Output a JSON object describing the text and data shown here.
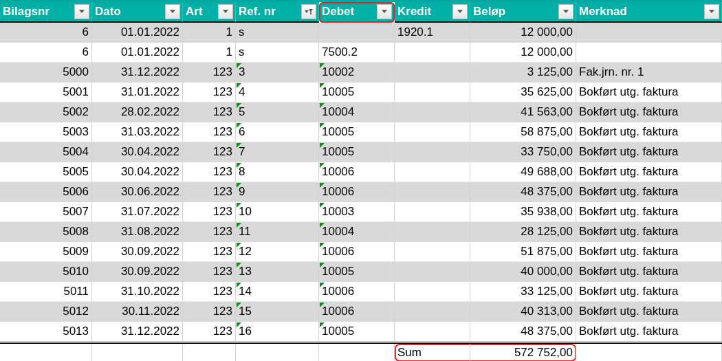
{
  "table": {
    "columns": [
      {
        "label": "Bilagsnr",
        "kind": "number",
        "filtered": false,
        "highlighted": false
      },
      {
        "label": "Dato",
        "kind": "number",
        "filtered": false,
        "highlighted": false
      },
      {
        "label": "Art",
        "kind": "number",
        "filtered": false,
        "highlighted": false
      },
      {
        "label": "Ref. nr",
        "kind": "text",
        "filtered": true,
        "highlighted": false
      },
      {
        "label": "Debet",
        "kind": "text",
        "filtered": false,
        "highlighted": true
      },
      {
        "label": "Kredit",
        "kind": "text",
        "filtered": false,
        "highlighted": false
      },
      {
        "label": "Beløp",
        "kind": "number",
        "filtered": false,
        "highlighted": false
      },
      {
        "label": "Merknad",
        "kind": "text",
        "filtered": false,
        "highlighted": false
      }
    ],
    "rows": [
      {
        "cells": [
          "6",
          "01.01.2022",
          "1",
          "s",
          "",
          "1920.1",
          "12 000,00",
          ""
        ],
        "number_as_text": false
      },
      {
        "cells": [
          "6",
          "01.01.2022",
          "1",
          "s",
          "7500.2",
          "",
          "12 000,00",
          ""
        ],
        "number_as_text": false
      },
      {
        "cells": [
          "5000",
          "31.12.2022",
          "123",
          "3",
          "10002",
          "",
          "3 125,00",
          "Fak.jrn. nr. 1"
        ],
        "number_as_text": true
      },
      {
        "cells": [
          "5001",
          "31.01.2022",
          "123",
          "4",
          "10005",
          "",
          "35 625,00",
          "Bokført utg. faktura"
        ],
        "number_as_text": true
      },
      {
        "cells": [
          "5002",
          "28.02.2022",
          "123",
          "5",
          "10004",
          "",
          "41 563,00",
          "Bokført utg. faktura"
        ],
        "number_as_text": true
      },
      {
        "cells": [
          "5003",
          "31.03.2022",
          "123",
          "6",
          "10005",
          "",
          "58 875,00",
          "Bokført utg. faktura"
        ],
        "number_as_text": true
      },
      {
        "cells": [
          "5004",
          "30.04.2022",
          "123",
          "7",
          "10005",
          "",
          "33 750,00",
          "Bokført utg. faktura"
        ],
        "number_as_text": true
      },
      {
        "cells": [
          "5005",
          "30.04.2022",
          "123",
          "8",
          "10006",
          "",
          "49 688,00",
          "Bokført utg. faktura"
        ],
        "number_as_text": true
      },
      {
        "cells": [
          "5006",
          "30.06.2022",
          "123",
          "9",
          "10006",
          "",
          "48 375,00",
          "Bokført utg. faktura"
        ],
        "number_as_text": true
      },
      {
        "cells": [
          "5007",
          "31.07.2022",
          "123",
          "10",
          "10003",
          "",
          "35 938,00",
          "Bokført utg. faktura"
        ],
        "number_as_text": true
      },
      {
        "cells": [
          "5008",
          "31.08.2022",
          "123",
          "11",
          "10004",
          "",
          "28 125,00",
          "Bokført utg. faktura"
        ],
        "number_as_text": true
      },
      {
        "cells": [
          "5009",
          "30.09.2022",
          "123",
          "12",
          "10006",
          "",
          "51 875,00",
          "Bokført utg. faktura"
        ],
        "number_as_text": true
      },
      {
        "cells": [
          "5010",
          "30.09.2022",
          "123",
          "13",
          "10005",
          "",
          "40 000,00",
          "Bokført utg. faktura"
        ],
        "number_as_text": true
      },
      {
        "cells": [
          "5011",
          "31.10.2022",
          "123",
          "14",
          "10006",
          "",
          "33 125,00",
          "Bokført utg. faktura"
        ],
        "number_as_text": true
      },
      {
        "cells": [
          "5012",
          "30.11.2022",
          "123",
          "15",
          "10006",
          "",
          "40 313,00",
          "Bokført utg. faktura"
        ],
        "number_as_text": true
      },
      {
        "cells": [
          "5013",
          "31.12.2022",
          "123",
          "16",
          "10005",
          "",
          "48 375,00",
          "Bokført utg. faktura"
        ],
        "number_as_text": true
      }
    ],
    "total": {
      "label": "Sum",
      "value": "572 752,00",
      "highlighted": true
    }
  }
}
